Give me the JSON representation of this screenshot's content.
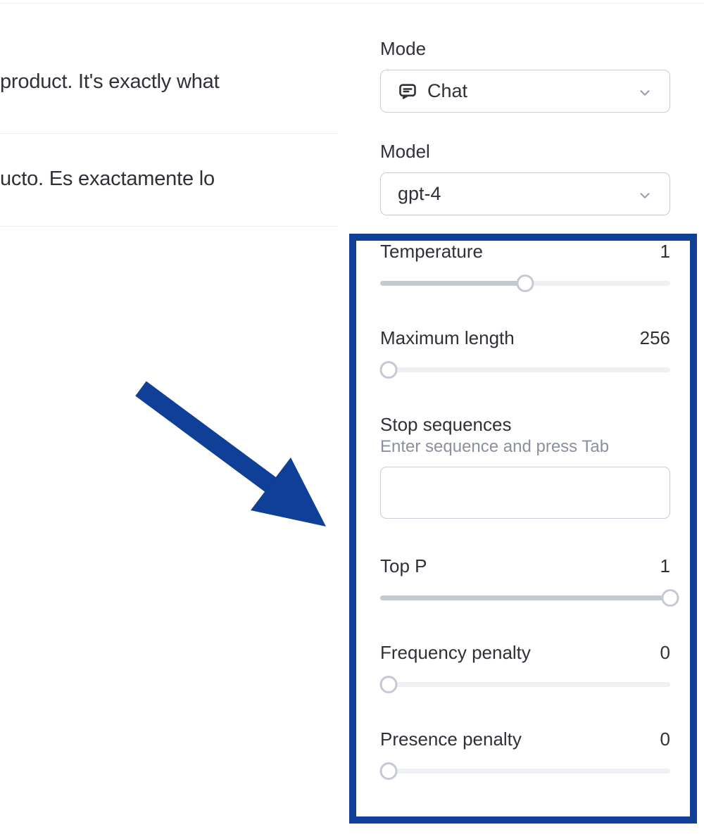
{
  "messages": {
    "line1": "product. It's exactly what",
    "line2": "ucto. Es exactamente lo"
  },
  "sidebar": {
    "mode": {
      "label": "Mode",
      "value": "Chat"
    },
    "model": {
      "label": "Model",
      "value": "gpt-4"
    }
  },
  "params": {
    "temperature": {
      "label": "Temperature",
      "value": "1",
      "fill_pct": 50,
      "thumb_pct": 50
    },
    "max_length": {
      "label": "Maximum length",
      "value": "256",
      "fill_pct": 0,
      "thumb_pct": 3
    },
    "stop": {
      "label": "Stop sequences",
      "hint": "Enter sequence and press Tab",
      "value": ""
    },
    "top_p": {
      "label": "Top P",
      "value": "1",
      "fill_pct": 100,
      "thumb_pct": 100
    },
    "freq_pen": {
      "label": "Frequency penalty",
      "value": "0",
      "fill_pct": 0,
      "thumb_pct": 3
    },
    "pres_pen": {
      "label": "Presence penalty",
      "value": "0",
      "fill_pct": 0,
      "thumb_pct": 3
    }
  },
  "colors": {
    "highlight": "#0f3f96"
  }
}
